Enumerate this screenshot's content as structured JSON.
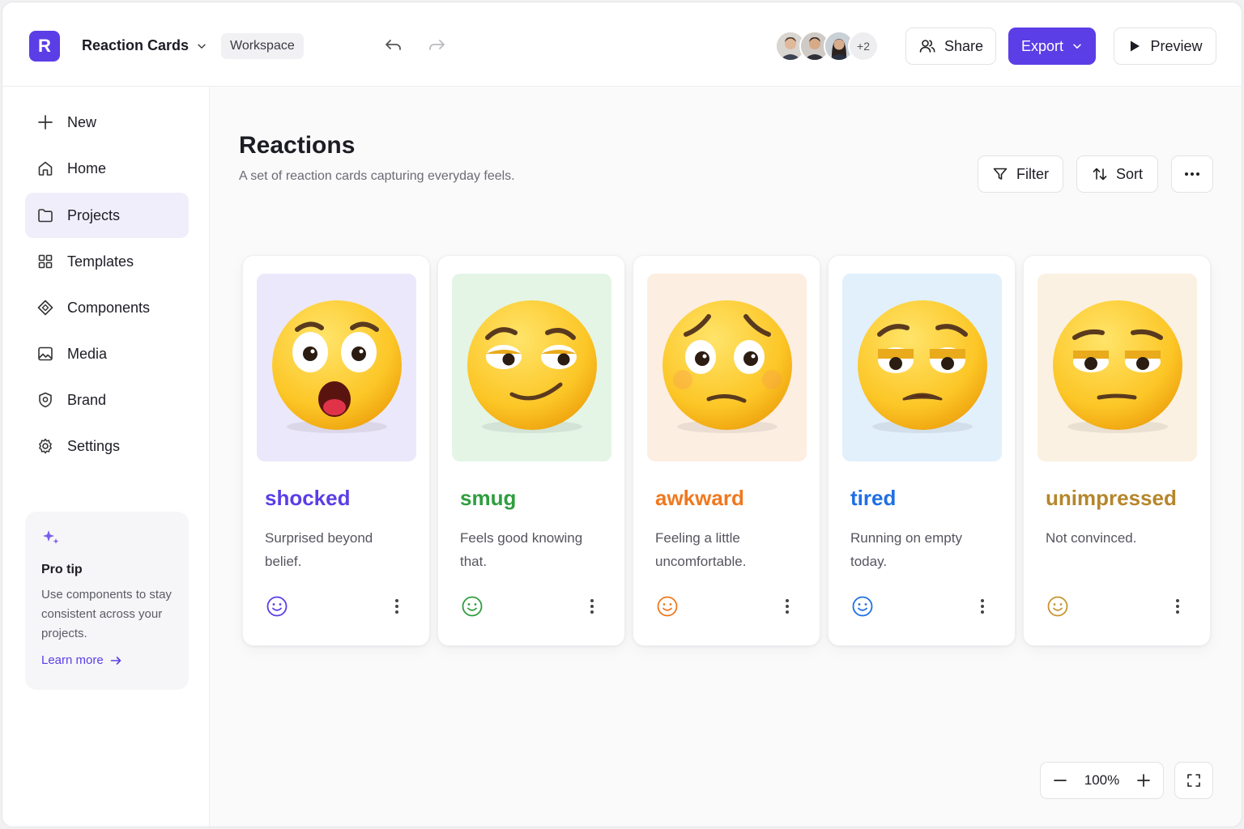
{
  "app": {
    "logo_letter": "R",
    "project_name": "Reaction Cards",
    "workspace_label": "Workspace",
    "collaborators_extra": "+2"
  },
  "toolbar": {
    "share_label": "Share",
    "export_label": "Export",
    "preview_label": "Preview"
  },
  "sidebar": {
    "items": [
      {
        "label": "New",
        "icon": "plus-icon"
      },
      {
        "label": "Home",
        "icon": "home-icon"
      },
      {
        "label": "Projects",
        "icon": "folder-icon",
        "active": true
      },
      {
        "label": "Templates",
        "icon": "grid-icon"
      },
      {
        "label": "Components",
        "icon": "component-icon"
      },
      {
        "label": "Media",
        "icon": "image-icon"
      },
      {
        "label": "Brand",
        "icon": "shield-icon"
      },
      {
        "label": "Settings",
        "icon": "gear-icon"
      }
    ],
    "tip": {
      "title": "Pro tip",
      "body": "Use components to stay consistent across your projects.",
      "link": "Learn more"
    }
  },
  "main": {
    "title": "Reactions",
    "subtitle": "A set of reaction cards capturing everyday feels.",
    "filter_label": "Filter",
    "sort_label": "Sort"
  },
  "cards": [
    {
      "title": "shocked",
      "desc": "Surprised beyond belief.",
      "color": "#5b3ee6",
      "bg": "#ece8fb"
    },
    {
      "title": "smug",
      "desc": "Feels good knowing that.",
      "color": "#2f9e3f",
      "bg": "#e4f5e6"
    },
    {
      "title": "awkward",
      "desc": "Feeling a little uncomfortable.",
      "color": "#f0781e",
      "bg": "#fdeee2"
    },
    {
      "title": "tired",
      "desc": "Running on empty today.",
      "color": "#1f6fe5",
      "bg": "#e2f0fc"
    },
    {
      "title": "unimpressed",
      "desc": "Not convinced.",
      "color": "#b6862c",
      "bg": "#fbf1e2"
    }
  ],
  "zoom": {
    "level": "100%"
  }
}
